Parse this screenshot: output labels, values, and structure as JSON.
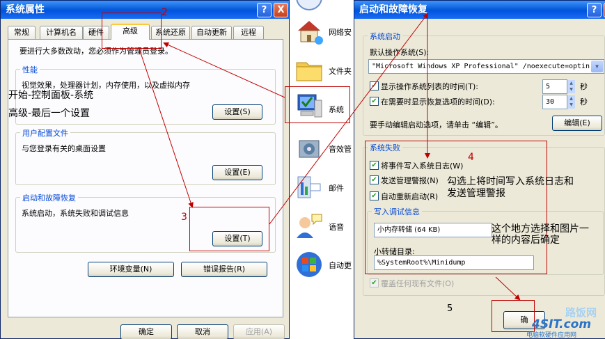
{
  "left_window": {
    "title": "系统属性",
    "help_btn": "?",
    "close_btn": "X",
    "tabs": [
      "常规",
      "计算机名",
      "硬件",
      "高级",
      "系统还原",
      "自动更新",
      "远程"
    ],
    "admin_notice": "要进行大多数改动，您必须作为管理员登录。",
    "performance": {
      "title": "性能",
      "desc": "视觉效果，处理器计划，内存使用，以及虚拟内存",
      "button": "设置(S)"
    },
    "user_profiles": {
      "title": "用户配置文件",
      "desc": "与您登录有关的桌面设置",
      "button": "设置(E)"
    },
    "startup_recovery": {
      "title": "启动和故障恢复",
      "desc": "系统启动，系统失败和调试信息",
      "button": "设置(T)"
    },
    "env_button": "环境变量(N)",
    "error_button": "错误报告(R)",
    "ok": "确定",
    "cancel": "取消",
    "apply": "应用(A)"
  },
  "control_panel": {
    "items": [
      {
        "label": "网络安",
        "icon": "network-icon"
      },
      {
        "label": "文件夹",
        "icon": "folder-icon"
      },
      {
        "label": "系统",
        "icon": "system-icon"
      },
      {
        "label": "音效管",
        "icon": "sound-icon"
      },
      {
        "label": "邮件",
        "icon": "mail-icon"
      },
      {
        "label": "语音",
        "icon": "speech-icon"
      },
      {
        "label": "自动更",
        "icon": "update-icon"
      }
    ]
  },
  "right_window": {
    "title": "启动和故障恢复",
    "help_btn": "?",
    "close_btn": "X",
    "system_startup": {
      "title": "系统启动",
      "default_os_label": "默认操作系统(S):",
      "default_os_value": "\"Microsoft Windows XP Professional\" /noexecute=optin",
      "show_list_label": "显示操作系统列表的时间(T):",
      "show_list_value": "5",
      "show_recovery_label": "在需要时显示恢复选项的时间(D):",
      "show_recovery_value": "30",
      "seconds": "秒",
      "edit_hint": "要手动编辑启动选项，请单击 “编辑”。",
      "edit_button": "编辑(E)"
    },
    "system_failure": {
      "title": "系统失败",
      "write_log": "将事件写入系统日志(W)",
      "send_alert": "发送管理警报(N)",
      "auto_restart": "自动重新启动(R)",
      "debug_title": "写入调试信息",
      "dump_type": "小内存转储 (64 KB)",
      "dump_dir_label": "小转储目录:",
      "dump_dir_value": "%SystemRoot%\\Minidump",
      "overwrite": "覆盖任何现有文件(O)"
    },
    "ok_partial": "确"
  },
  "annotations": {
    "step_path": "开始-控制面板-系统",
    "step_advanced": "高级-最后一个设置",
    "n2": "2",
    "n3": "3",
    "n4": "4",
    "n5": "5",
    "note_failure": "勾选上将时间写入系统日志和发送管理警报",
    "note_failure_l1": "勾选上将时间写入系统日志和",
    "note_failure_l2": "发送管理警报",
    "note_debug_l1": "这个地方选择和图片一",
    "note_debug_l2": "样的内容后确定"
  },
  "watermark": {
    "logo": "4SIT.com",
    "cn": "电脑软硬件应用网",
    "overlay_cn": "路饭网"
  }
}
